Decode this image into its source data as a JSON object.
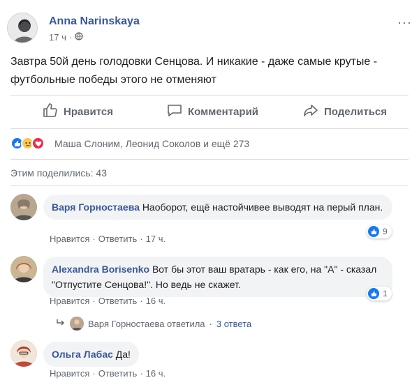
{
  "post": {
    "author": "Anna Narinskaya",
    "time": "17 ч",
    "dot": "·",
    "more": "···",
    "text": "Завтра 50й день голодовки Сенцова. И никакие - даже самые крутые - футбольные победы этого не отменяют"
  },
  "actions": {
    "like": "Нравится",
    "comment": "Комментарий",
    "share": "Поделиться"
  },
  "reactions": {
    "icons": [
      "like-icon",
      "sad-icon",
      "love-icon"
    ],
    "names": "Маша Слоним, Леонид Соколов и ещё 273"
  },
  "shares": "Этим поделились: 43",
  "comments": [
    {
      "author": "Варя Горностаева",
      "text": "Наоборот, ещё настойчивее выводят на перый план.",
      "like_label": "Нравится",
      "reply_label": "Ответить",
      "time": "17 ч.",
      "likes": "9"
    },
    {
      "author": "Alexandra Borisenko",
      "text": "Вот бы этот ваш вратарь - как его, на \"А\" - сказал \"Отпустите Сенцова!\". Но ведь не скажет.",
      "like_label": "Нравится",
      "reply_label": "Ответить",
      "time": "16 ч.",
      "likes": "1"
    },
    {
      "author": "Ольга Лабас",
      "text": "Да!",
      "like_label": "Нравится",
      "reply_label": "Ответить",
      "time": "16 ч."
    }
  ],
  "reply_thread": {
    "text": "Варя Горностаева ответила",
    "dot": "·",
    "count": "3 ответа"
  },
  "dot": "·",
  "colors": {
    "link": "#385898",
    "like_blue": "#1877f2",
    "muted": "#606770",
    "bubble": "#f2f3f5"
  }
}
